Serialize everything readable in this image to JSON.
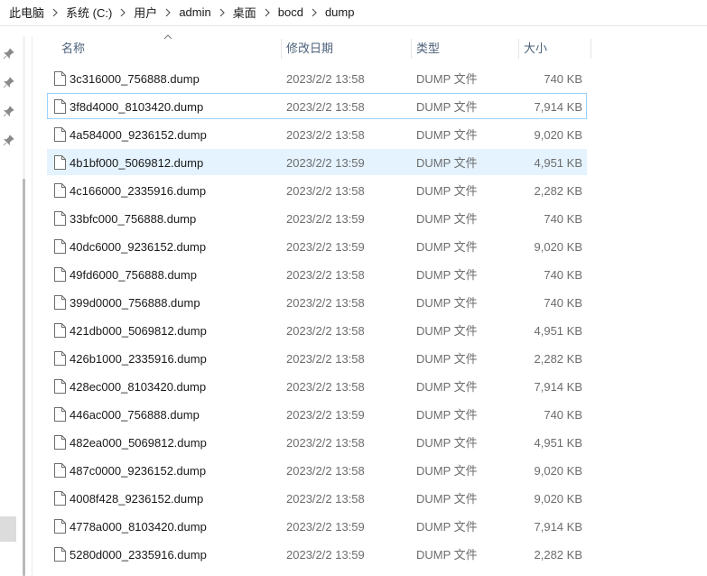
{
  "breadcrumb": [
    "此电脑",
    "系统 (C:)",
    "用户",
    "admin",
    "桌面",
    "bocd",
    "dump"
  ],
  "columns": {
    "name": "名称",
    "date": "修改日期",
    "type": "类型",
    "size": "大小"
  },
  "colors": {
    "header_text": "#4c607a",
    "hover_bg": "#e5f3ff",
    "focus_border": "#99d1ff"
  },
  "files": [
    {
      "name": "3c316000_756888.dump",
      "date": "2023/2/2 13:58",
      "type": "DUMP 文件",
      "size": "740 KB"
    },
    {
      "name": "3f8d4000_8103420.dump",
      "date": "2023/2/2 13:58",
      "type": "DUMP 文件",
      "size": "7,914 KB"
    },
    {
      "name": "4a584000_9236152.dump",
      "date": "2023/2/2 13:58",
      "type": "DUMP 文件",
      "size": "9,020 KB"
    },
    {
      "name": "4b1bf000_5069812.dump",
      "date": "2023/2/2 13:59",
      "type": "DUMP 文件",
      "size": "4,951 KB"
    },
    {
      "name": "4c166000_2335916.dump",
      "date": "2023/2/2 13:58",
      "type": "DUMP 文件",
      "size": "2,282 KB"
    },
    {
      "name": "33bfc000_756888.dump",
      "date": "2023/2/2 13:59",
      "type": "DUMP 文件",
      "size": "740 KB"
    },
    {
      "name": "40dc6000_9236152.dump",
      "date": "2023/2/2 13:59",
      "type": "DUMP 文件",
      "size": "9,020 KB"
    },
    {
      "name": "49fd6000_756888.dump",
      "date": "2023/2/2 13:58",
      "type": "DUMP 文件",
      "size": "740 KB"
    },
    {
      "name": "399d0000_756888.dump",
      "date": "2023/2/2 13:58",
      "type": "DUMP 文件",
      "size": "740 KB"
    },
    {
      "name": "421db000_5069812.dump",
      "date": "2023/2/2 13:58",
      "type": "DUMP 文件",
      "size": "4,951 KB"
    },
    {
      "name": "426b1000_2335916.dump",
      "date": "2023/2/2 13:58",
      "type": "DUMP 文件",
      "size": "2,282 KB"
    },
    {
      "name": "428ec000_8103420.dump",
      "date": "2023/2/2 13:58",
      "type": "DUMP 文件",
      "size": "7,914 KB"
    },
    {
      "name": "446ac000_756888.dump",
      "date": "2023/2/2 13:59",
      "type": "DUMP 文件",
      "size": "740 KB"
    },
    {
      "name": "482ea000_5069812.dump",
      "date": "2023/2/2 13:58",
      "type": "DUMP 文件",
      "size": "4,951 KB"
    },
    {
      "name": "487c0000_9236152.dump",
      "date": "2023/2/2 13:58",
      "type": "DUMP 文件",
      "size": "9,020 KB"
    },
    {
      "name": "4008f428_9236152.dump",
      "date": "2023/2/2 13:58",
      "type": "DUMP 文件",
      "size": "9,020 KB"
    },
    {
      "name": "4778a000_8103420.dump",
      "date": "2023/2/2 13:59",
      "type": "DUMP 文件",
      "size": "7,914 KB"
    },
    {
      "name": "5280d000_2335916.dump",
      "date": "2023/2/2 13:59",
      "type": "DUMP 文件",
      "size": "2,282 KB"
    }
  ]
}
